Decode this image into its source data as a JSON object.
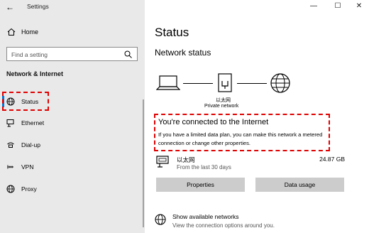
{
  "app": {
    "title": "Settings"
  },
  "window_controls": {
    "minimize": "—",
    "maximize": "☐",
    "close": "✕"
  },
  "sidebar": {
    "home_label": "Home",
    "search_placeholder": "Find a setting",
    "section_title": "Network & Internet",
    "items": [
      {
        "label": "Status",
        "icon": "globe-icon",
        "active": true
      },
      {
        "label": "Ethernet",
        "icon": "ethernet-icon"
      },
      {
        "label": "Dial-up",
        "icon": "phone-icon"
      },
      {
        "label": "VPN",
        "icon": "vpn-icon"
      },
      {
        "label": "Proxy",
        "icon": "globe-icon"
      }
    ]
  },
  "main": {
    "title": "Status",
    "network_status_heading": "Network status",
    "diagram": {
      "adapter_name": "以太网",
      "adapter_type": "Private network"
    },
    "connected": {
      "title": "You're connected to the Internet",
      "description": "If you have a limited data plan, you can make this network a metered connection or change other properties."
    },
    "usage": {
      "name": "以太网",
      "period": "From the last 30 days",
      "amount": "24.87 GB"
    },
    "buttons": {
      "properties": "Properties",
      "data_usage": "Data usage"
    },
    "show_networks": {
      "title": "Show available networks",
      "subtitle": "View the connection options around you."
    }
  },
  "colors": {
    "accent": "#0078d7",
    "highlight": "#e00000",
    "sidebar_bg": "#e9e9e9",
    "button_bg": "#cccccc"
  }
}
